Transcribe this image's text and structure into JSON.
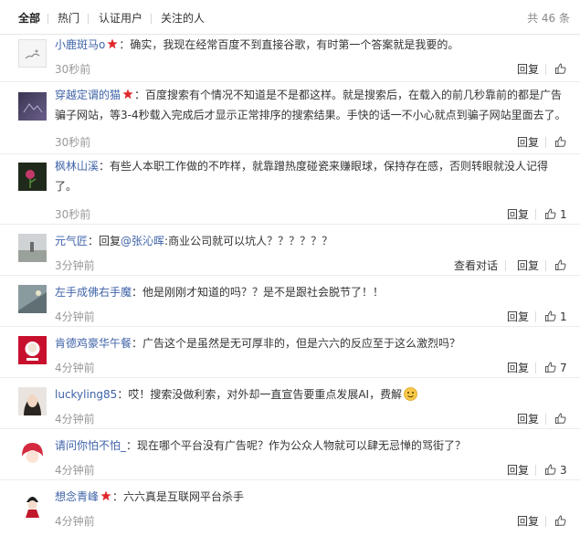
{
  "tabs": {
    "all": "全部",
    "hot": "热门",
    "verified": "认证用户",
    "following": "关注的人",
    "total": "共 46 条"
  },
  "actions": {
    "reply": "回复",
    "view_conversation": "查看对话"
  },
  "comments": [
    {
      "user": "小鹿斑马o",
      "vip": true,
      "prefix": "",
      "mention": "",
      "text": "：确实，我现在经常百度不到直接谷歌，有时第一个答案就是我要的。",
      "time": "30秒前",
      "likes": ""
    },
    {
      "user": "穿越定谓的猫",
      "vip": true,
      "prefix": "",
      "mention": "",
      "text": "：百度搜索有个情况不知道是不是都这样。就是搜索后，在载入的前几秒靠前的都是广告骗子网站，等3-4秒载入完成后才显示正常排序的搜索结果。手快的话一不小心就点到骗子网站里面去了。",
      "time": "30秒前",
      "likes": ""
    },
    {
      "user": "枫林山溪",
      "vip": false,
      "prefix": "",
      "mention": "",
      "text": "：有些人本职工作做的不咋样，就靠蹭热度碰瓷来赚眼球，保持存在感，否则转眼就没人记得了。",
      "time": "30秒前",
      "likes": "1"
    },
    {
      "user": "元气匠",
      "vip": false,
      "prefix": "：回复",
      "mention": "@张沁晖",
      "text": ":商业公司就可以坑人？？？？？？",
      "time": "3分钟前",
      "likes": ""
    },
    {
      "user": "左手成佛右手魔",
      "vip": false,
      "prefix": "",
      "mention": "",
      "text": "：他是刚刚才知道的吗？？是不是跟社会脱节了！！",
      "time": "4分钟前",
      "likes": "1"
    },
    {
      "user": "肯德鸡豪华午餐",
      "vip": false,
      "prefix": "",
      "mention": "",
      "text": "：广告这个是虽然是无可厚非的，但是六六的反应至于这么激烈吗？",
      "time": "4分钟前",
      "likes": "7"
    },
    {
      "user": "luckyling85",
      "vip": false,
      "prefix": "",
      "mention": "",
      "text": "：哎！搜索没做利索，对外却一直宣告要重点发展AI，费解",
      "time": "4分钟前",
      "likes": ""
    },
    {
      "user": "请问你怕不怕_",
      "vip": false,
      "prefix": "",
      "mention": "",
      "text": "：现在哪个平台没有广告呢？作为公众人物就可以肆无忌惮的骂街了？",
      "time": "4分钟前",
      "likes": "3"
    },
    {
      "user": "想念青峰",
      "vip": true,
      "prefix": "",
      "mention": "",
      "text": "：六六真是互联网平台杀手",
      "time": "4分钟前",
      "likes": ""
    }
  ],
  "colors": {
    "link": "#3f63a8",
    "vip_star": "#e0282d",
    "meta": "#999999",
    "divider": "#ececec"
  },
  "icons": {
    "vip": "vip-star-icon",
    "like": "thumbs-up-icon",
    "emoji": "smiley-emoji-icon"
  }
}
